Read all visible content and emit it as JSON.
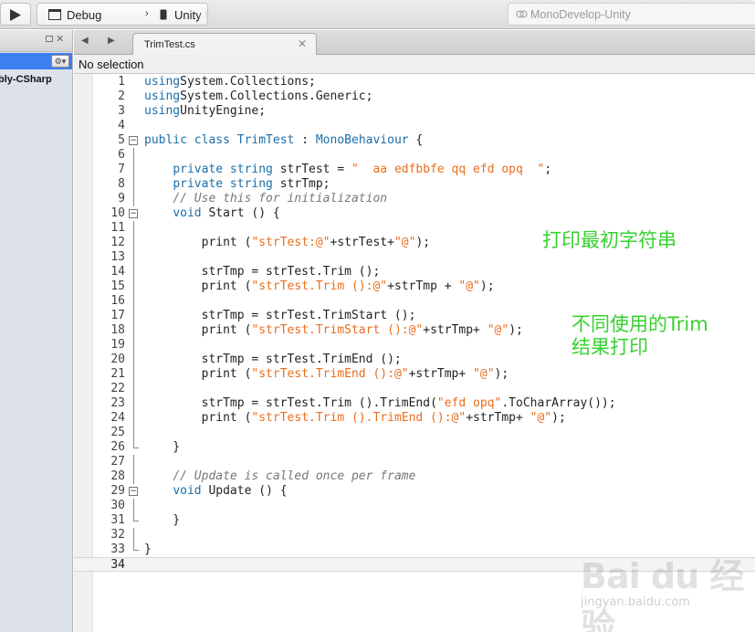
{
  "toolbar": {
    "run_icon": "play-icon",
    "configuration": "Debug",
    "target": "Unity Editor",
    "status": "MonoDevelop-Unity"
  },
  "solution_pad": {
    "options_icon": "gear-icon",
    "item_label": "bly-CSharp"
  },
  "tabs": [
    {
      "label": "TrimTest.cs",
      "close_icon": "close-icon"
    }
  ],
  "path_bar": {
    "label": "No selection"
  },
  "editor": {
    "current_line": 34,
    "lines": [
      {
        "n": "1",
        "fold": "",
        "segs": [
          [
            "kw",
            "using"
          ],
          [
            "",
            "System.Collections;"
          ]
        ]
      },
      {
        "n": "2",
        "fold": "",
        "segs": [
          [
            "kw",
            "using"
          ],
          [
            "",
            "System.Collections.Generic;"
          ]
        ]
      },
      {
        "n": "3",
        "fold": "",
        "segs": [
          [
            "kw",
            "using"
          ],
          [
            "",
            "UnityEngine;"
          ]
        ]
      },
      {
        "n": "4",
        "fold": "",
        "segs": []
      },
      {
        "n": "5",
        "fold": "open",
        "segs": [
          [
            "kw",
            "public class"
          ],
          [
            "",
            " "
          ],
          [
            "ty",
            "TrimTest"
          ],
          [
            "",
            " : "
          ],
          [
            "ty",
            "MonoBehaviour"
          ],
          [
            "",
            " {"
          ]
        ]
      },
      {
        "n": "6",
        "fold": "line",
        "segs": []
      },
      {
        "n": "7",
        "fold": "line",
        "segs": [
          [
            "",
            "    "
          ],
          [
            "kw",
            "private string"
          ],
          [
            "",
            " strTest = "
          ],
          [
            "st",
            "\"  aa edfbbfe qq efd opq  \""
          ],
          [
            "",
            ";"
          ]
        ]
      },
      {
        "n": "8",
        "fold": "line",
        "segs": [
          [
            "",
            "    "
          ],
          [
            "kw",
            "private string"
          ],
          [
            "",
            " strTmp;"
          ]
        ]
      },
      {
        "n": "9",
        "fold": "line",
        "segs": [
          [
            "",
            "    "
          ],
          [
            "cm",
            "// Use this for initialization"
          ]
        ]
      },
      {
        "n": "10",
        "fold": "open",
        "segs": [
          [
            "",
            "    "
          ],
          [
            "kw",
            "void"
          ],
          [
            "",
            " Start () {"
          ]
        ]
      },
      {
        "n": "11",
        "fold": "line",
        "segs": []
      },
      {
        "n": "12",
        "fold": "line",
        "segs": [
          [
            "",
            "        print ("
          ],
          [
            "st",
            "\"strTest:@\""
          ],
          [
            "",
            "+strTest+"
          ],
          [
            "st",
            "\"@\""
          ],
          [
            "",
            ");"
          ]
        ]
      },
      {
        "n": "13",
        "fold": "line",
        "segs": []
      },
      {
        "n": "14",
        "fold": "line",
        "segs": [
          [
            "",
            "        strTmp = strTest.Trim ();"
          ]
        ]
      },
      {
        "n": "15",
        "fold": "line",
        "segs": [
          [
            "",
            "        print ("
          ],
          [
            "st",
            "\"strTest.Trim ():@\""
          ],
          [
            "",
            "+strTmp + "
          ],
          [
            "st",
            "\"@\""
          ],
          [
            "",
            ");"
          ]
        ]
      },
      {
        "n": "16",
        "fold": "line",
        "segs": []
      },
      {
        "n": "17",
        "fold": "line",
        "segs": [
          [
            "",
            "        strTmp = strTest.TrimStart ();"
          ]
        ]
      },
      {
        "n": "18",
        "fold": "line",
        "segs": [
          [
            "",
            "        print ("
          ],
          [
            "st",
            "\"strTest.TrimStart ():@\""
          ],
          [
            "",
            "+strTmp+ "
          ],
          [
            "st",
            "\"@\""
          ],
          [
            "",
            ");"
          ]
        ]
      },
      {
        "n": "19",
        "fold": "line",
        "segs": []
      },
      {
        "n": "20",
        "fold": "line",
        "segs": [
          [
            "",
            "        strTmp = strTest.TrimEnd ();"
          ]
        ]
      },
      {
        "n": "21",
        "fold": "line",
        "segs": [
          [
            "",
            "        print ("
          ],
          [
            "st",
            "\"strTest.TrimEnd ():@\""
          ],
          [
            "",
            "+strTmp+ "
          ],
          [
            "st",
            "\"@\""
          ],
          [
            "",
            ");"
          ]
        ]
      },
      {
        "n": "22",
        "fold": "line",
        "segs": []
      },
      {
        "n": "23",
        "fold": "line",
        "segs": [
          [
            "",
            "        strTmp = strTest.Trim ().TrimEnd("
          ],
          [
            "st",
            "\"efd opq\""
          ],
          [
            "",
            ".ToCharArray());"
          ]
        ]
      },
      {
        "n": "24",
        "fold": "line",
        "segs": [
          [
            "",
            "        print ("
          ],
          [
            "st",
            "\"strTest.Trim ().TrimEnd ():@\""
          ],
          [
            "",
            "+strTmp+ "
          ],
          [
            "st",
            "\"@\""
          ],
          [
            "",
            ");"
          ]
        ]
      },
      {
        "n": "25",
        "fold": "line",
        "segs": []
      },
      {
        "n": "26",
        "fold": "end",
        "segs": [
          [
            "",
            "    }"
          ]
        ]
      },
      {
        "n": "27",
        "fold": "line",
        "segs": []
      },
      {
        "n": "28",
        "fold": "line",
        "segs": [
          [
            "",
            "    "
          ],
          [
            "cm",
            "// Update is called once per frame"
          ]
        ]
      },
      {
        "n": "29",
        "fold": "open",
        "segs": [
          [
            "",
            "    "
          ],
          [
            "kw",
            "void"
          ],
          [
            "",
            " Update () {"
          ]
        ]
      },
      {
        "n": "30",
        "fold": "line",
        "segs": []
      },
      {
        "n": "31",
        "fold": "end",
        "segs": [
          [
            "",
            "    }"
          ]
        ]
      },
      {
        "n": "32",
        "fold": "line",
        "segs": []
      },
      {
        "n": "33",
        "fold": "end",
        "segs": [
          [
            "",
            "}"
          ]
        ]
      },
      {
        "n": "34",
        "fold": "",
        "segs": []
      }
    ]
  },
  "annotations": {
    "print_initial": "打印最初字符串",
    "compare_line1": "不同使用的Trim",
    "compare_line2": "结果打印"
  },
  "watermark": {
    "logo": "Bai du 经验",
    "url": "jingyan.baidu.com"
  },
  "colors": {
    "keyword": "#1b6ea8",
    "string": "#ea6d1d",
    "comment": "#777777",
    "annotation": "#36d12f",
    "selection": "#3d7ff1"
  }
}
